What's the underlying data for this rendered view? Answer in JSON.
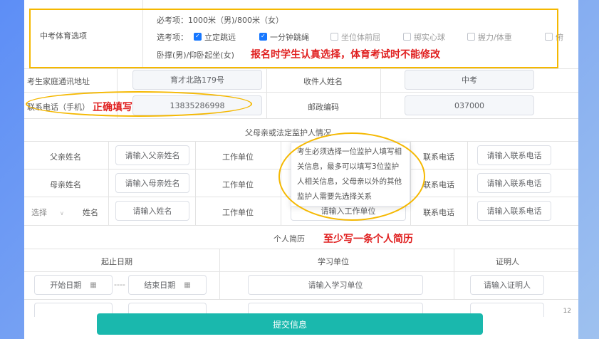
{
  "pe": {
    "label": "中考体育选项",
    "required_line": "必考项：1000米（男)/800米（女）",
    "elective_label": "选考项：",
    "options": [
      {
        "label": "立定跳远",
        "checked": true
      },
      {
        "label": "一分钟跳绳",
        "checked": true
      },
      {
        "label": "坐位体前屈",
        "checked": false
      },
      {
        "label": "掷实心球",
        "checked": false
      },
      {
        "label": "握力/体重",
        "checked": false
      },
      {
        "label": "俯",
        "checked": false
      }
    ],
    "option_cont": "卧撑(男)/仰卧起坐(女)",
    "note": "报名时学生认真选择，体育考试时不能修改"
  },
  "address": {
    "label": "考生家庭通讯地址",
    "value": "育才北路179号"
  },
  "recipient": {
    "label": "收件人姓名",
    "value": "中考"
  },
  "phone": {
    "label": "联系电话（手机）",
    "value": "13835286998",
    "note": "正确填写"
  },
  "postcode": {
    "label": "邮政编码",
    "value": "037000"
  },
  "guardian": {
    "section_title": "父母亲或法定监护人情况",
    "father_label": "父亲姓名",
    "father_placeholder": "请输入父亲姓名",
    "mother_label": "母亲姓名",
    "mother_placeholder": "请输入母亲姓名",
    "select_placeholder": "选择",
    "name_label": "姓名",
    "name_placeholder": "请输入姓名",
    "work_label": "工作单位",
    "work_placeholder": "请输入工作单位",
    "contact_label": "联系电话",
    "contact_placeholder": "请输入联系电话",
    "tooltip": "考生必须选择一位监护人填写相关信息，最多可以填写3位监护人相关信息，父母亲以外的其他监护人需要先选择关系"
  },
  "resume": {
    "section_title": "个人简历",
    "note": "至少写一条个人简历",
    "col_date": "起止日期",
    "col_school": "学习单位",
    "col_witness": "证明人",
    "start_placeholder": "开始日期",
    "end_placeholder": "结束日期",
    "date_sep": "----",
    "school_placeholder": "请输入学习单位",
    "witness_placeholder": "请输入证明人"
  },
  "submit_label": "提交信息",
  "page_number": "12",
  "colors": {
    "accent": "#1ab8ad",
    "highlight": "#f5b800",
    "note": "#e02020",
    "check": "#1677ff"
  }
}
